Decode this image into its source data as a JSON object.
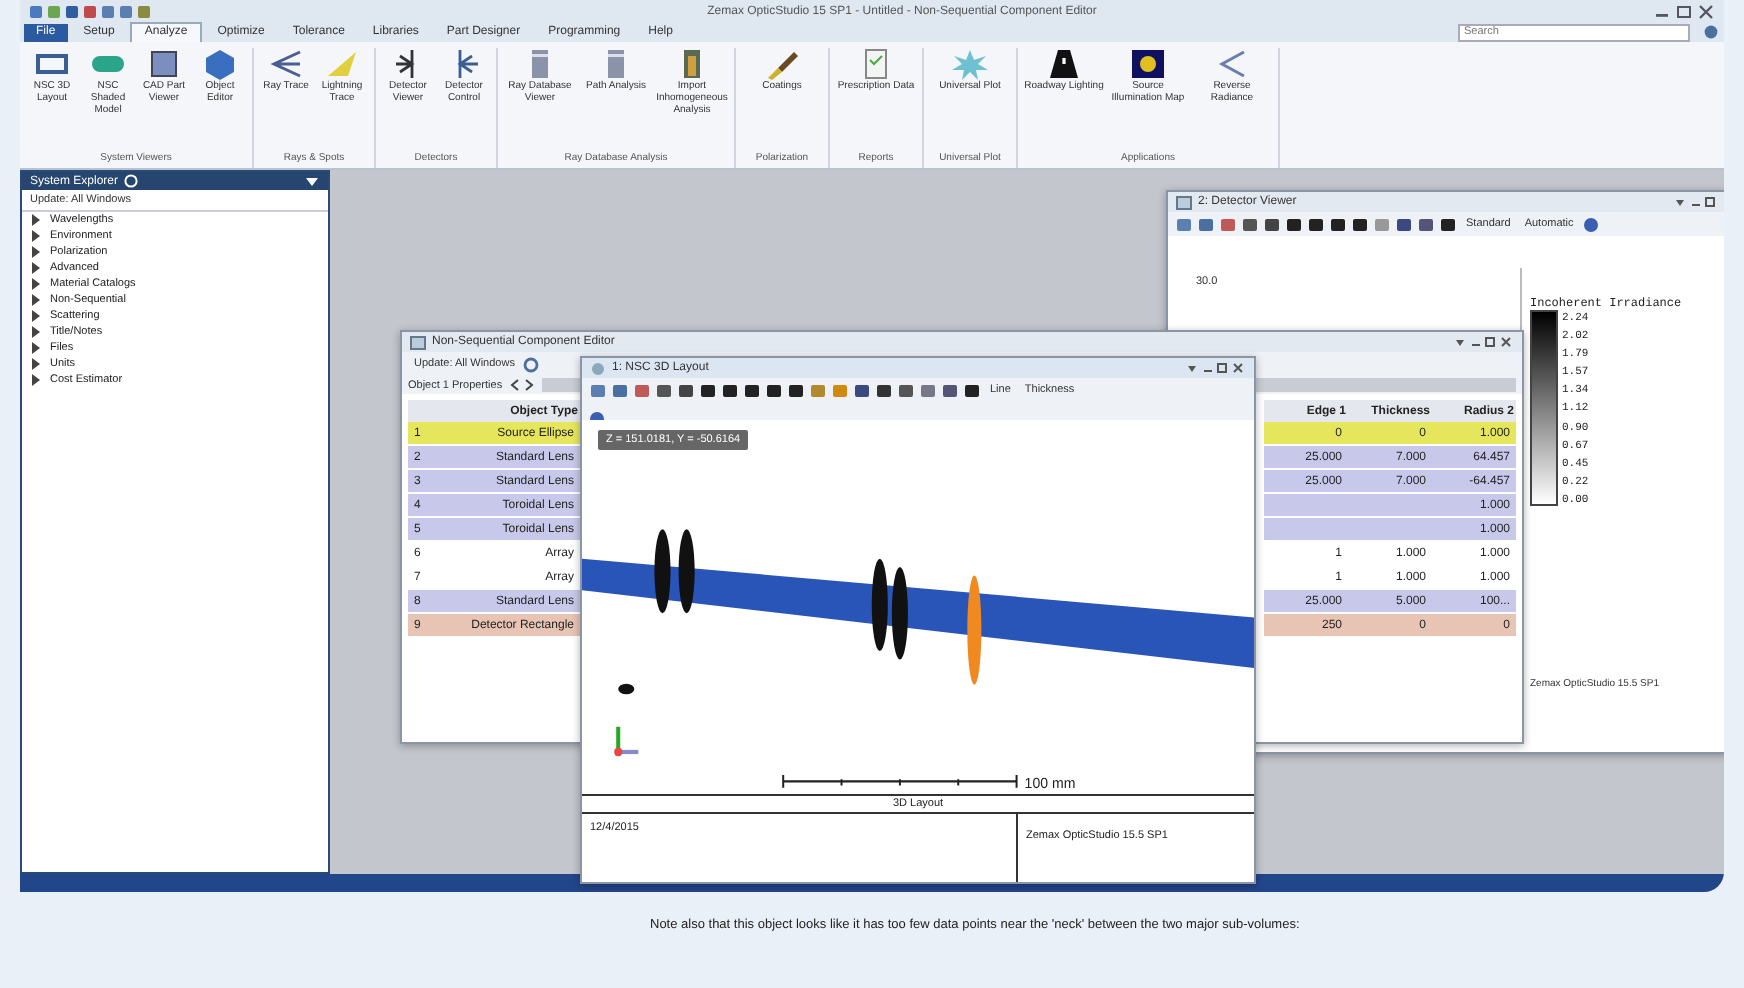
{
  "app": {
    "title": "Zemax OpticStudio 15 SP1 - Untitled - Non-Sequential Component Editor",
    "search_placeholder": "Search"
  },
  "menu_tabs": [
    {
      "label": "File",
      "selected": false,
      "kind": "file"
    },
    {
      "label": "Setup",
      "selected": false,
      "kind": "tab"
    },
    {
      "label": "Analyze",
      "selected": true,
      "kind": "tab"
    },
    {
      "label": "Optimize",
      "selected": false,
      "kind": "tab"
    },
    {
      "label": "Tolerance",
      "selected": false,
      "kind": "tab"
    },
    {
      "label": "Libraries",
      "selected": false,
      "kind": "tab"
    },
    {
      "label": "Part Designer",
      "selected": false,
      "kind": "tab"
    },
    {
      "label": "Programming",
      "selected": false,
      "kind": "tab"
    },
    {
      "label": "Help",
      "selected": false,
      "kind": "tab"
    }
  ],
  "ribbon_groups": [
    {
      "label": "System Viewers",
      "buttons": [
        {
          "label": "NSC 3D Layout",
          "kind": "frame"
        },
        {
          "label": "NSC Shaded Model",
          "kind": "pill"
        },
        {
          "label": "CAD Part Viewer",
          "kind": "square"
        },
        {
          "label": "Object Editor",
          "kind": "cube"
        }
      ]
    },
    {
      "label": "Rays & Spots",
      "buttons": [
        {
          "label": "Ray Trace",
          "kind": "rays"
        },
        {
          "label": "Lightning Trace",
          "kind": "star"
        }
      ]
    },
    {
      "label": "Detectors",
      "buttons": [
        {
          "label": "Detector Viewer",
          "kind": "bracket"
        },
        {
          "label": "Detector Control",
          "kind": "bracket2"
        }
      ]
    },
    {
      "label": "Ray Database Analysis",
      "buttons": [
        {
          "label": "Ray Database Viewer",
          "kind": "bin"
        },
        {
          "label": "Path Analysis",
          "kind": "bin"
        },
        {
          "label": "Import Inhomogeneous Analysis",
          "kind": "bars"
        }
      ]
    },
    {
      "label": "Polarization",
      "buttons": [
        {
          "label": "Coatings",
          "kind": "brush"
        }
      ]
    },
    {
      "label": "Reports",
      "buttons": [
        {
          "label": "Prescription Data",
          "kind": "doc"
        }
      ]
    },
    {
      "label": "Universal Plot",
      "buttons": [
        {
          "label": "Universal Plot",
          "kind": "burst"
        }
      ]
    },
    {
      "label": "Applications",
      "buttons": [
        {
          "label": "Roadway Lighting",
          "kind": "road"
        },
        {
          "label": "Source Illumination Map",
          "kind": "map"
        },
        {
          "label": "Reverse Radiance",
          "kind": "cone"
        }
      ]
    }
  ],
  "explorer": {
    "title": "System Explorer",
    "update": "Update: All Windows",
    "items": [
      {
        "label": "Wavelengths",
        "expanded": false
      },
      {
        "label": "Environment",
        "expanded": false
      },
      {
        "label": "Polarization",
        "expanded": false
      },
      {
        "label": "Advanced",
        "expanded": false
      },
      {
        "label": "Material Catalogs",
        "expanded": false
      },
      {
        "label": "Non-Sequential",
        "expanded": false
      },
      {
        "label": "Scattering",
        "expanded": false
      },
      {
        "label": "Title/Notes",
        "expanded": false
      },
      {
        "label": "Files",
        "expanded": false
      },
      {
        "label": "Units",
        "expanded": false
      },
      {
        "label": "Cost Estimator",
        "expanded": false
      }
    ]
  },
  "detector_viewer": {
    "title": "2: Detector Viewer",
    "dropdowns": [
      "Standard",
      "Automatic"
    ],
    "tick": "30.0",
    "legend_title": "Incoherent Irradiance",
    "legend_values": [
      "2.24",
      "2.02",
      "1.79",
      "1.57",
      "1.34",
      "1.12",
      "0.90",
      "0.67",
      "0.45",
      "0.22",
      "0.00"
    ],
    "footer": "Zemax OpticStudio 15.5 SP1"
  },
  "editor": {
    "title": "Non-Sequential Component Editor",
    "update": "Update: All Windows",
    "properties": "Object 1 Properties",
    "columns": [
      "Object Type",
      "Edge 1",
      "Thickness",
      "Radius 2"
    ],
    "rows": [
      {
        "number": "1",
        "color": "#e6e65c",
        "cells": [
          "Source Ellipse",
          "0",
          "0",
          "1.000"
        ]
      },
      {
        "number": "2",
        "color": "#c8c8ea",
        "cells": [
          "Standard Lens",
          "25.000",
          "7.000",
          "64.457"
        ]
      },
      {
        "number": "3",
        "color": "#c8c8ea",
        "cells": [
          "Standard Lens",
          "25.000",
          "7.000",
          "-64.457"
        ]
      },
      {
        "number": "4",
        "color": "#c8c8ea",
        "cells": [
          "Toroidal Lens",
          "",
          "",
          "1.000"
        ]
      },
      {
        "number": "5",
        "color": "#c8c8ea",
        "cells": [
          "Toroidal Lens",
          "",
          "",
          "1.000"
        ]
      },
      {
        "number": "6",
        "color": "#ffffff",
        "cells": [
          "Array",
          "1",
          "1.000",
          "1.000"
        ]
      },
      {
        "number": "7",
        "color": "#ffffff",
        "cells": [
          "Array",
          "1",
          "1.000",
          "1.000"
        ]
      },
      {
        "number": "8",
        "color": "#c8c8ea",
        "cells": [
          "Standard Lens",
          "25.000",
          "5.000",
          "100..."
        ]
      },
      {
        "number": "9",
        "color": "#e8c4b4",
        "cells": [
          "Detector Rectangle",
          "250",
          "0",
          "0"
        ]
      }
    ]
  },
  "layout": {
    "title": "1: NSC 3D Layout",
    "toolbar_labels": [
      "Line",
      "Thickness"
    ],
    "tooltip": "Z = 151.0181, Y = -50.6164",
    "scale": "100 mm",
    "caption": "3D Layout",
    "date": "12/4/2015",
    "product": "Zemax OpticStudio 15.5 SP1"
  },
  "note": "Note also that this object looks like it has too few data points near the 'neck' between the two major sub-volumes:"
}
